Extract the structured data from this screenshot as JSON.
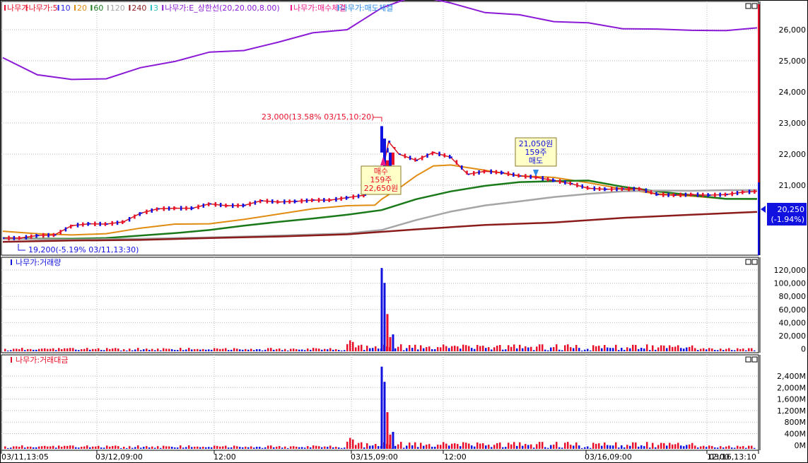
{
  "colors": {
    "up": "#e8102a",
    "down": "#1111e0",
    "ma5": "#d6181c",
    "ma10": "#2a2ae6",
    "ma20": "#e08c10",
    "ma60": "#1a7a1a",
    "ma120": "#a6a6a6",
    "ma240": "#8b1c1c",
    "ma3": "#2bc4c4",
    "upper_limit": "#8b1ad6",
    "buy": "#ee1a8a",
    "sell": "#2a8ae6",
    "grid": "#b8b8b8",
    "axis": "#000000"
  },
  "price_panel": {
    "legend": [
      {
        "text": "나무가",
        "color": "#e8102a"
      },
      {
        "text": "나무가:5",
        "color": "#e8102a"
      },
      {
        "text": "10",
        "color": "#2a2ae6"
      },
      {
        "text": "20",
        "color": "#e08c10"
      },
      {
        "text": "60",
        "color": "#1a7a1a"
      },
      {
        "text": "120",
        "color": "#a6a6a6"
      },
      {
        "text": "240",
        "color": "#8b1c1c"
      },
      {
        "text": "3",
        "color": "#2bc4c4"
      },
      {
        "text": "나무가:E_상한선(20,20.00,8.00)",
        "color": "#8b1ad6"
      },
      {
        "text": "나무가:매수체결",
        "color": "#ee1a8a"
      },
      {
        "text": "나무가:매도체결",
        "color": "#2a8ae6"
      }
    ],
    "high_note": "23,000(13.58% 03/15,10:20)",
    "low_note": "19,200(-5.19% 03/11,13:30)",
    "buy_box": [
      "매수",
      "159주",
      "22,650원"
    ],
    "sell_box": [
      "21,050원",
      "159주",
      "매도"
    ],
    "current_price": "20,250",
    "current_change": "(-1.94%)"
  },
  "volume_panel": {
    "title": "나무가:거래량"
  },
  "amount_panel": {
    "title": "나무가:거래대금"
  },
  "x_axis_labels": [
    "03/11,13:05",
    "03/12,09:00",
    "12:00",
    "03/15,09:00",
    "12:00",
    "03/16,09:00",
    "12:00",
    "03/16,13:10"
  ],
  "chart_data": [
    {
      "type": "line",
      "title": "나무가",
      "y_ticks": [
        "26,000",
        "25,000",
        "24,000",
        "23,000",
        "22,000",
        "21,000"
      ],
      "ylim": [
        19000,
        26500
      ],
      "x_labels": [
        "03/11,13:05",
        "03/12,09:00",
        "12:00",
        "03/15,09:00",
        "12:00",
        "03/16,09:00",
        "12:00",
        "03/16,13:10"
      ],
      "series": [
        {
          "name": "E_상한선(20,20.00,8.00)",
          "x": [
            0,
            10,
            20,
            30,
            40,
            50,
            60,
            70,
            80,
            90,
            100,
            110,
            120,
            130,
            140,
            150,
            160,
            170,
            180,
            190,
            200,
            210,
            219
          ],
          "values": [
            25100,
            24550,
            24400,
            24420,
            24780,
            24980,
            25280,
            25330,
            25600,
            25900,
            26000,
            26700,
            27100,
            26860,
            26550,
            26480,
            26260,
            26220,
            26030,
            26020,
            25980,
            25970,
            26060
          ]
        },
        {
          "name": "20",
          "x": [
            0,
            10,
            20,
            30,
            40,
            50,
            60,
            70,
            80,
            90,
            100,
            108,
            110,
            115,
            120,
            125,
            130,
            140,
            150,
            160,
            170,
            180,
            190,
            200,
            210,
            219
          ],
          "values": [
            19520,
            19440,
            19400,
            19440,
            19620,
            19750,
            19760,
            19900,
            20070,
            20240,
            20340,
            20360,
            20550,
            20900,
            21300,
            21620,
            21650,
            21480,
            21300,
            21250,
            21080,
            20880,
            20720,
            20650,
            20560,
            20550
          ]
        },
        {
          "name": "60",
          "x": [
            0,
            10,
            20,
            30,
            40,
            50,
            60,
            70,
            80,
            90,
            100,
            110,
            120,
            130,
            140,
            150,
            160,
            170,
            180,
            190,
            200,
            210,
            219
          ],
          "values": [
            19300,
            19280,
            19280,
            19300,
            19380,
            19460,
            19560,
            19700,
            19820,
            19930,
            20050,
            20200,
            20550,
            20800,
            20980,
            21100,
            21130,
            21150,
            20950,
            20800,
            20680,
            20560,
            20560
          ]
        },
        {
          "name": "120",
          "x": [
            0,
            20,
            40,
            60,
            80,
            100,
            110,
            120,
            130,
            140,
            150,
            160,
            170,
            180,
            190,
            200,
            210,
            219
          ],
          "values": [
            19280,
            19250,
            19280,
            19320,
            19380,
            19450,
            19560,
            19880,
            20150,
            20350,
            20480,
            20620,
            20720,
            20800,
            20830,
            20820,
            20840,
            20840
          ]
        },
        {
          "name": "240",
          "x": [
            0,
            20,
            40,
            60,
            80,
            100,
            120,
            140,
            160,
            180,
            200,
            219
          ],
          "values": [
            19180,
            19220,
            19240,
            19300,
            19350,
            19420,
            19580,
            19720,
            19800,
            19950,
            20050,
            20140
          ]
        },
        {
          "name": "5",
          "x": [
            0,
            5,
            10,
            15,
            20,
            25,
            30,
            35,
            40,
            45,
            50,
            55,
            60,
            65,
            70,
            75,
            80,
            85,
            90,
            95,
            100,
            105,
            110,
            112,
            115,
            120,
            125,
            130,
            135,
            140,
            145,
            150,
            155,
            160,
            165,
            170,
            175,
            180,
            185,
            190,
            195,
            200,
            205,
            210,
            215,
            219
          ],
          "values": [
            19300,
            19300,
            19380,
            19400,
            19700,
            19760,
            19750,
            19820,
            20100,
            20240,
            20260,
            20260,
            20400,
            20340,
            20350,
            20500,
            20460,
            20480,
            20520,
            20520,
            20600,
            20680,
            21300,
            22400,
            22000,
            21800,
            22050,
            21900,
            21350,
            21450,
            21400,
            21300,
            21250,
            21150,
            21050,
            20900,
            20870,
            20880,
            20880,
            20700,
            20680,
            20700,
            20680,
            20700,
            20780,
            20800
          ]
        }
      ]
    },
    {
      "type": "bar",
      "title": "나무가:거래량",
      "y_ticks": [
        "120,000",
        "100,000",
        "80,000",
        "60,000",
        "40,000",
        "20,000",
        "0"
      ],
      "ylim": [
        0,
        130000
      ],
      "peak_values": [
        123000,
        101000,
        55000,
        21000,
        25000
      ]
    },
    {
      "type": "bar",
      "title": "나무가:거래대금",
      "y_ticks": [
        "2,400M",
        "2,000M",
        "1,600M",
        "1,200M",
        "800M",
        "400M",
        "0M"
      ],
      "ylim": [
        0,
        2600
      ],
      "peak_values": [
        2710,
        2210,
        1210,
        470,
        560
      ]
    }
  ]
}
